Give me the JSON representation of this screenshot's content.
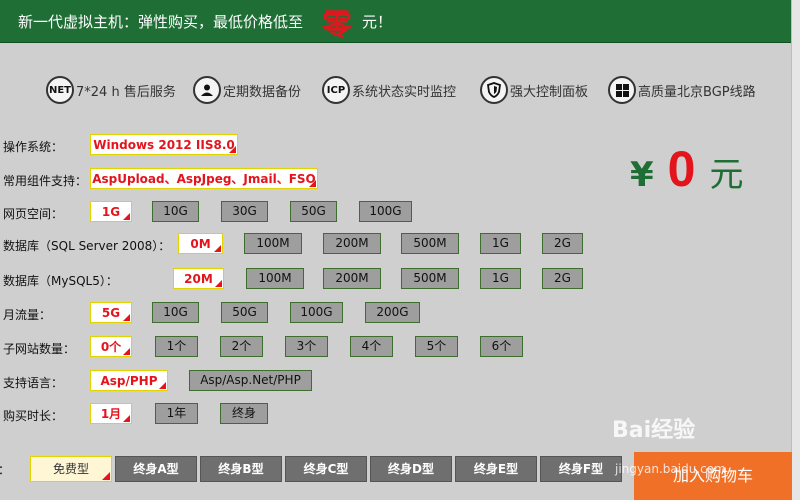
{
  "banner": {
    "text": "新一代虚拟主机：弹性购买，最低价格低至",
    "zero": "零",
    "yuan": "元！"
  },
  "features": [
    {
      "icon": "NET",
      "label": "7*24 h 售后服务"
    },
    {
      "icon": "user-icon",
      "label": "定期数据备份"
    },
    {
      "icon": "ICP",
      "label": "系统状态实时监控"
    },
    {
      "icon": "shield-icon",
      "label": "强大控制面板"
    },
    {
      "icon": "windows-icon",
      "label": "高质量北京BGP线路"
    }
  ],
  "config": {
    "os": {
      "label": "操作系统：",
      "selected": "Windows 2012 IIS8.0"
    },
    "components": {
      "label": "常用组件支持：",
      "selected": "AspUpload、AspJpeg、Jmail、FSO"
    },
    "space": {
      "label": "网页空间：",
      "selected": "1G",
      "options": [
        "10G",
        "30G",
        "50G",
        "100G"
      ]
    },
    "sqlserver": {
      "label": "数据库（SQL Server 2008）：",
      "selected": "0M",
      "options": [
        "100M",
        "200M",
        "500M",
        "1G",
        "2G"
      ]
    },
    "mysql": {
      "label": "数据库（MySQL5）：",
      "selected": "20M",
      "options": [
        "100M",
        "200M",
        "500M",
        "1G",
        "2G"
      ]
    },
    "traffic": {
      "label": "月流量：",
      "selected": "5G",
      "options": [
        "10G",
        "50G",
        "100G",
        "200G"
      ]
    },
    "subsites": {
      "label": "子网站数量：",
      "selected": "0个",
      "options": [
        "1个",
        "2个",
        "3个",
        "4个",
        "5个",
        "6个"
      ]
    },
    "language": {
      "label": "支持语言：",
      "selected": "Asp/PHP",
      "options": [
        "Asp/Asp.Net/PHP"
      ]
    },
    "duration": {
      "label": "购买时长：",
      "selected": "1月",
      "options": [
        "1年",
        "终身"
      ]
    }
  },
  "price": {
    "currency": "¥",
    "value": "0",
    "unit": "元"
  },
  "plans": {
    "prefix": "型：",
    "items": [
      "免费型",
      "终身A型",
      "终身B型",
      "终身C型",
      "终身D型",
      "终身E型",
      "终身F型"
    ]
  },
  "cart_label": "加入购物车",
  "watermark": {
    "line1": "Bai经验",
    "line2": "jingyan.baidu.com"
  },
  "colors": {
    "brand_green": "#1e6e35",
    "accent_red": "#e3141c",
    "cart_orange": "#f07028"
  }
}
